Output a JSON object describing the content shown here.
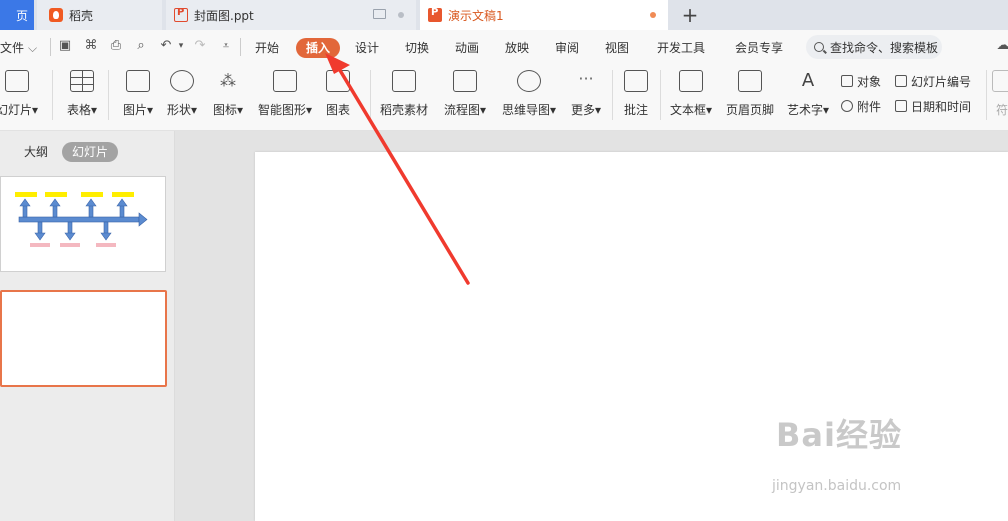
{
  "tabs": {
    "home_label": "页",
    "daoke": "稻壳",
    "cover_file": "封面图.ppt",
    "active_doc": "演示文稿1",
    "add": "+"
  },
  "menu": {
    "file": "文件",
    "items": [
      "开始",
      "插入",
      "设计",
      "切换",
      "动画",
      "放映",
      "审阅",
      "视图",
      "开发工具",
      "会员专享"
    ],
    "search_placeholder": "查找命令、搜索模板"
  },
  "ribbon": {
    "slide": "幻灯片",
    "table": "表格",
    "picture": "图片",
    "shape": "形状",
    "icon": "图标",
    "smartart": "智能图形",
    "chart": "图表",
    "daoke_material": "稻壳素材",
    "flowchart": "流程图",
    "mindmap": "思维导图",
    "more": "更多",
    "comment": "批注",
    "textbox": "文本框",
    "header_footer": "页眉页脚",
    "wordart": "艺术字",
    "object": "对象",
    "slide_number": "幻灯片编号",
    "attachment": "附件",
    "datetime": "日期和时间",
    "symbol": "符"
  },
  "panel": {
    "outline": "大纲",
    "slides": "幻灯片"
  },
  "watermark": {
    "brand": "Bai经验",
    "url": "jingyan.baidu.com"
  },
  "colors": {
    "accent": "#e2673a",
    "arrow": "#f03a2e",
    "tab_active_text": "#d9581f"
  }
}
